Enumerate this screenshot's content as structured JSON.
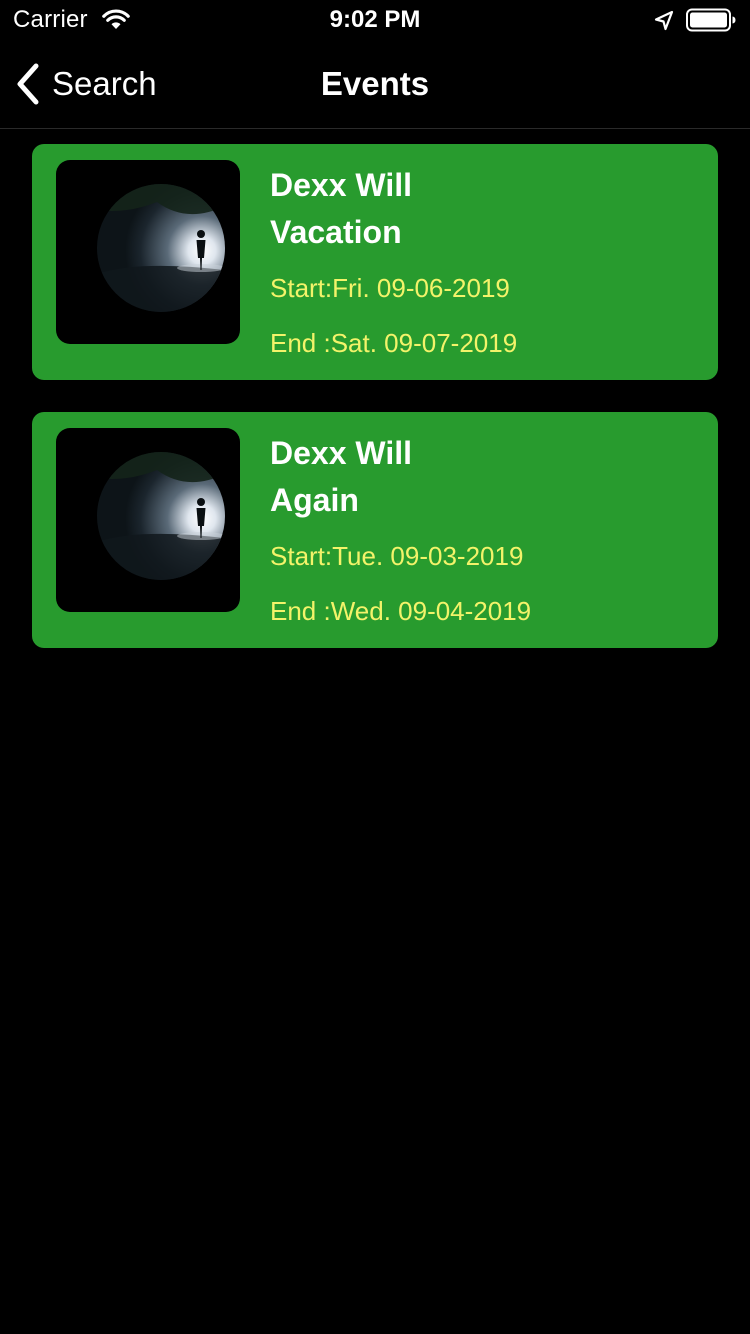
{
  "status_bar": {
    "carrier": "Carrier",
    "time": "9:02 PM",
    "icons": [
      "wifi-icon",
      "location-arrow-icon",
      "battery-icon"
    ]
  },
  "nav": {
    "back_label": "Search",
    "title": "Events"
  },
  "colors": {
    "background": "#000000",
    "card": "#289b2e",
    "date_text": "#f3f36a",
    "title_text": "#ffffff"
  },
  "events": [
    {
      "title_line1": "Dexx Will",
      "title_line2": "Vacation",
      "start": "Start:Fri. 09-06-2019",
      "end": "End :Sat. 09-07-2019"
    },
    {
      "title_line1": "Dexx Will",
      "title_line2": "Again",
      "start": "Start:Tue. 09-03-2019",
      "end": "End :Wed. 09-04-2019"
    }
  ]
}
